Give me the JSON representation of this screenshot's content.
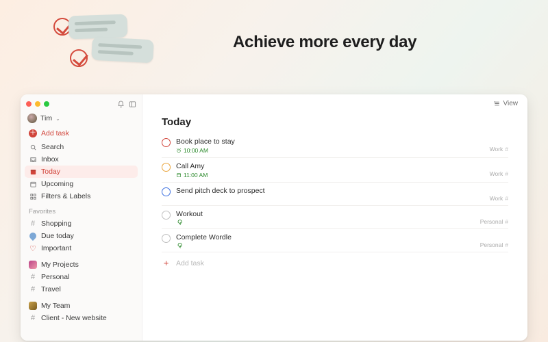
{
  "hero": {
    "text": "Achieve more every day"
  },
  "user": {
    "name": "Tim"
  },
  "sidebar": {
    "add_task": "Add task",
    "nav": [
      {
        "label": "Search",
        "icon": "search"
      },
      {
        "label": "Inbox",
        "icon": "inbox"
      },
      {
        "label": "Today",
        "icon": "calendar-today",
        "active": true
      },
      {
        "label": "Upcoming",
        "icon": "calendar"
      },
      {
        "label": "Filters & Labels",
        "icon": "grid"
      }
    ],
    "favorites_label": "Favorites",
    "favorites": [
      {
        "label": "Shopping",
        "icon": "hash"
      },
      {
        "label": "Due today",
        "icon": "drop"
      },
      {
        "label": "Important",
        "icon": "heart"
      }
    ],
    "projects_headers": [
      {
        "label": "My Projects",
        "icon": "grad1"
      },
      {
        "label": "My Team",
        "icon": "grad2"
      }
    ],
    "projects_group_1": [
      {
        "label": "Personal"
      },
      {
        "label": "Travel"
      }
    ],
    "projects_group_2": [
      {
        "label": "Client - New website"
      }
    ]
  },
  "view_button": "View",
  "page": {
    "title": "Today",
    "add_task": "Add task"
  },
  "tasks": [
    {
      "name": "Book place to stay",
      "priority": "p1",
      "time": "10:00 AM",
      "recurring": false,
      "meta_icon": "alarm",
      "project": "Work"
    },
    {
      "name": "Call Amy",
      "priority": "p2",
      "time": "11:00 AM",
      "recurring": false,
      "meta_icon": "calendar",
      "project": "Work"
    },
    {
      "name": "Send pitch deck to prospect",
      "priority": "p3",
      "time": "",
      "recurring": false,
      "meta_icon": "",
      "project": "Work"
    },
    {
      "name": "Workout",
      "priority": "p4",
      "time": "",
      "recurring": true,
      "meta_icon": "",
      "project": "Personal"
    },
    {
      "name": "Complete Wordle",
      "priority": "p4",
      "time": "",
      "recurring": true,
      "meta_icon": "",
      "project": "Personal"
    }
  ]
}
